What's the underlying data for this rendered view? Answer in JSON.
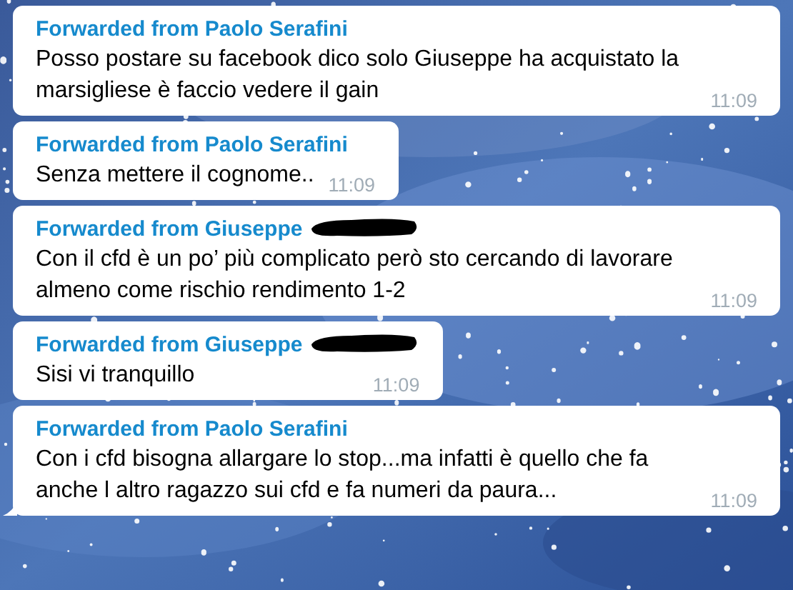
{
  "messages": [
    {
      "forwarded_from": "Forwarded from Paolo Serafini",
      "sender_redacted": false,
      "text": "Posso postare su facebook dico solo Giuseppe ha acquistato la marsigliese è faccio vedere il gain",
      "time": "11:09",
      "tail": false
    },
    {
      "forwarded_from": "Forwarded from Paolo Serafini",
      "sender_redacted": false,
      "text": "Senza mettere il cognome..",
      "time": "11:09",
      "tail": false
    },
    {
      "forwarded_from": "Forwarded from Giuseppe",
      "sender_redacted": true,
      "text": "Con il cfd è un po’ più complicato però sto cercando di lavorare almeno come rischio rendimento 1-2",
      "time": "11:09",
      "tail": false
    },
    {
      "forwarded_from": "Forwarded from Giuseppe",
      "sender_redacted": true,
      "text": "Sisi vi tranquillo",
      "time": "11:09",
      "tail": false
    },
    {
      "forwarded_from": "Forwarded from Paolo Serafini",
      "sender_redacted": false,
      "text": "Con i cfd bisogna allargare lo stop...ma infatti è quello che fa anche l altro ragazzo sui cfd e fa numeri da paura...",
      "time": "11:09",
      "tail": true
    }
  ]
}
